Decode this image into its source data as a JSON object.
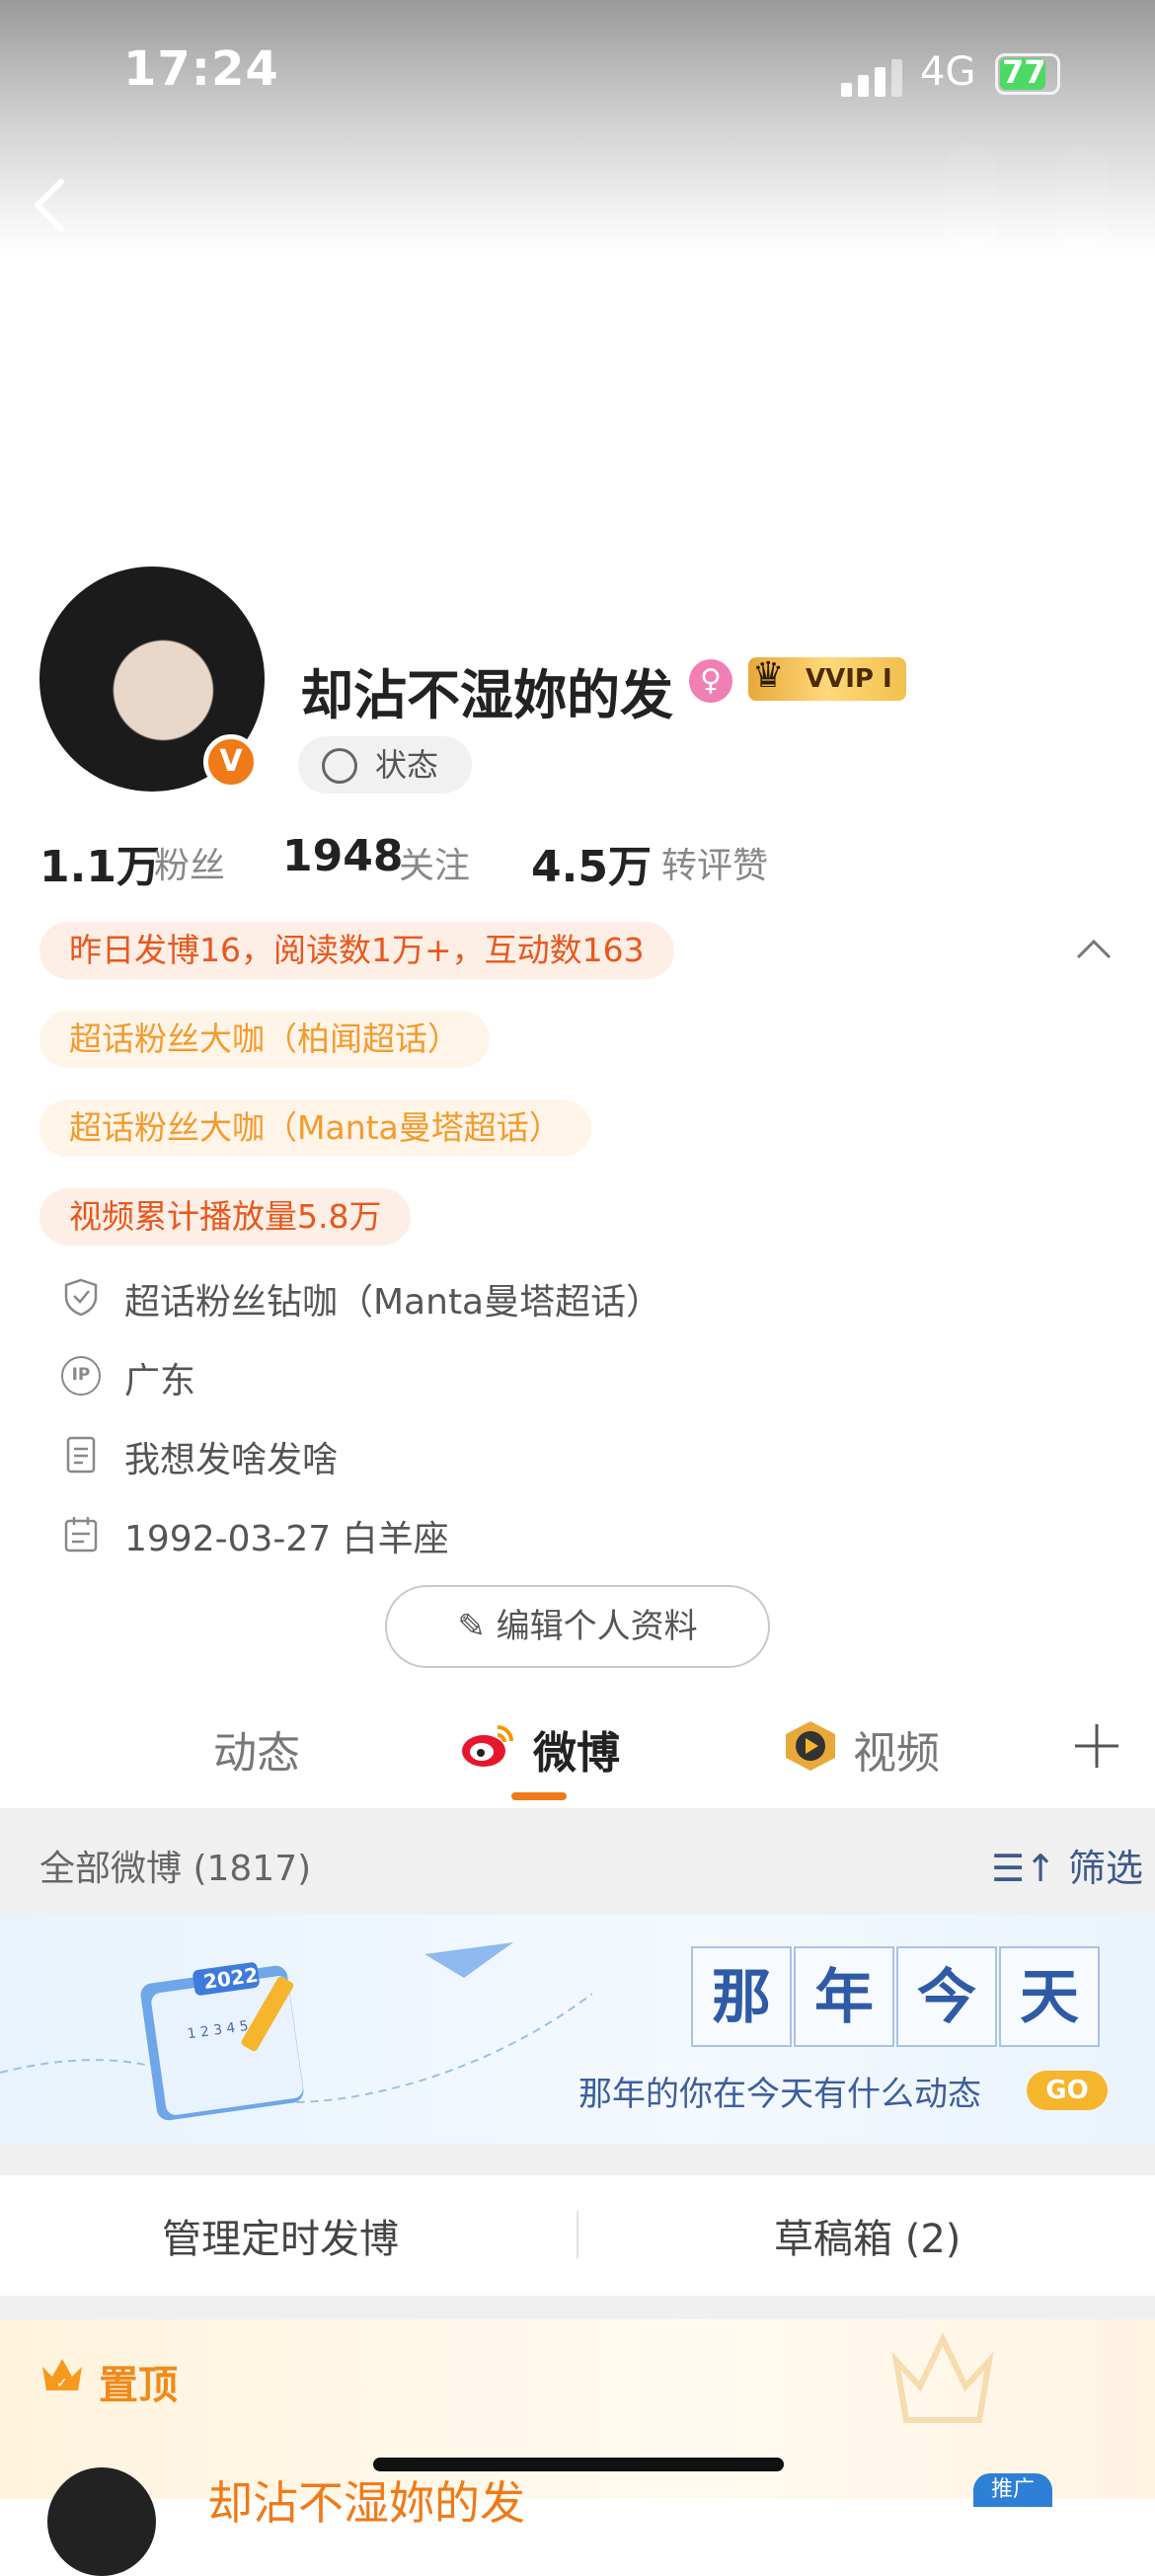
{
  "status_bar": {
    "time": "17:24",
    "carrier": "4G",
    "battery": "77"
  },
  "profile": {
    "username": "却沾不湿妳的发",
    "vip_badge": "VVIP Ⅰ",
    "verified_badge": "V",
    "state_label": "状态",
    "stats": [
      {
        "num": "1.1万",
        "label": "粉丝"
      },
      {
        "num": "1948",
        "label": "关注"
      },
      {
        "num": "4.5万",
        "label": "转评赞"
      }
    ],
    "tags": [
      "昨日发博16，阅读数1万+，互动数163",
      "超话粉丝大咖（柏闻超话）",
      "超话粉丝大咖（Manta曼塔超话）",
      "视频累计播放量5.8万"
    ],
    "info": [
      {
        "icon": "shield-icon",
        "text": "超话粉丝钻咖（Manta曼塔超话）"
      },
      {
        "icon": "ip-icon",
        "text": "广东",
        "icon_text": "IP"
      },
      {
        "icon": "document-icon",
        "text": "我想发啥发啥"
      },
      {
        "icon": "calendar-icon",
        "text": "1992-03-27 白羊座"
      }
    ],
    "edit_button": "编辑个人资料"
  },
  "tabs": [
    {
      "label": "动态",
      "active": false
    },
    {
      "label": "微博",
      "active": true
    },
    {
      "label": "视频",
      "active": false
    }
  ],
  "filter": {
    "title": "全部微博 (1817)",
    "button": "筛选"
  },
  "banner": {
    "chars": [
      "那",
      "年",
      "今",
      "天"
    ],
    "subtitle": "那年的你在今天有什么动态",
    "go": "GO",
    "calendar_year": "2022",
    "calendar_nums": "1 2 3 4 5 6"
  },
  "manage": {
    "left": "管理定时发博",
    "right": "草稿箱 (2)"
  },
  "pinned": {
    "label": "置顶",
    "post_name": "却沾不湿妳的发",
    "promo": "推广"
  },
  "colors": {
    "accent": "#f07a17",
    "link_blue": "#3d5a8a",
    "tag_red": "#e7581d",
    "tag_orange": "#f39b2c"
  }
}
